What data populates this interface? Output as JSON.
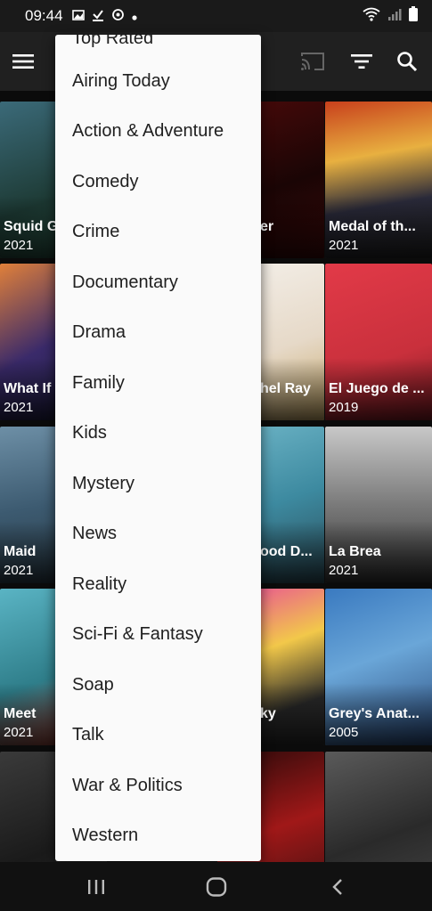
{
  "status": {
    "time": "09:44"
  },
  "menu": {
    "items": [
      "Top Rated",
      "Airing Today",
      "Action & Adventure",
      "Comedy",
      "Crime",
      "Documentary",
      "Drama",
      "Family",
      "Kids",
      "Mystery",
      "News",
      "Reality",
      "Sci-Fi & Fantasy",
      "Soap",
      "Talk",
      "War & Politics",
      "Western"
    ]
  },
  "posters": [
    {
      "title": "Squid G",
      "year": "2021"
    },
    {
      "title": "er",
      "year": ""
    },
    {
      "title": "Medal of th...",
      "year": "2021"
    },
    {
      "title": "What If",
      "year": "2021"
    },
    {
      "title": "hel Ray",
      "year": ""
    },
    {
      "title": "El Juego de ...",
      "year": "2019"
    },
    {
      "title": "Maid",
      "year": "2021"
    },
    {
      "title": "ood D...",
      "year": ""
    },
    {
      "title": "La Brea",
      "year": "2021"
    },
    {
      "title": "Meet",
      "year": "2021"
    },
    {
      "title": "ky",
      "year": ""
    },
    {
      "title": "Grey's Anat...",
      "year": "2005"
    },
    {
      "title": "",
      "year": ""
    },
    {
      "title": "",
      "year": ""
    },
    {
      "title": "",
      "year": ""
    }
  ],
  "colors": {
    "toolbar": "#202020",
    "menu_bg": "#fafafa",
    "menu_text": "#202020"
  }
}
